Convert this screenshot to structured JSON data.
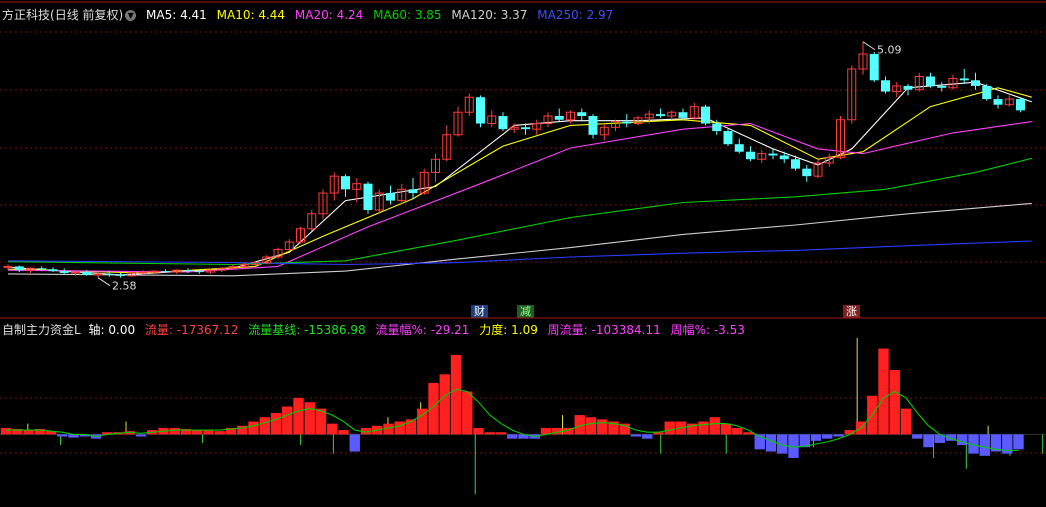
{
  "main_header": {
    "stock_name": "方正科技",
    "period_label": "(日线 前复权)",
    "ma5": "MA5: 4.41",
    "ma10": "MA10: 4.44",
    "ma20": "MA20: 4.24",
    "ma60": "MA60: 3.85",
    "ma120": "MA120: 3.37",
    "ma250": "MA250: 2.97"
  },
  "indicator_header": {
    "name": "自制主力资金L",
    "axis": "轴: 0.00",
    "flow": "流量: -17367.12",
    "flow_base": "流量基线: -15386.98",
    "flow_pct": "流量幅%: -29.21",
    "strength": "力度: 1.09",
    "week_flow": "周流量: -103384.11",
    "week_pct": "周幅%: -3.53"
  },
  "markers": {
    "fin": "财",
    "reduce": "减",
    "rise": "涨"
  },
  "colors": {
    "up": "#ff3c3c",
    "down": "#54ffff",
    "ma5": "#ffffff",
    "ma10": "#ffff00",
    "ma20": "#ff40ff",
    "ma60": "#00d000",
    "ma120": "#cfcfcf",
    "ma250": "#2a3cff",
    "flow_pos": "#ff2020",
    "flow_neg": "#5a5aff",
    "flow_line": "#00cc00",
    "grid": "#7a1010"
  },
  "chart_data": [
    {
      "type": "candlestick",
      "title": "方正科技 (日线 前复权)",
      "ylim": [
        2.3,
        5.3
      ],
      "high_label": "5.09",
      "low_label": "2.58",
      "candles": [
        [
          2.69,
          2.72,
          2.66,
          2.7
        ],
        [
          2.7,
          2.71,
          2.64,
          2.66
        ],
        [
          2.66,
          2.69,
          2.63,
          2.68
        ],
        [
          2.68,
          2.7,
          2.65,
          2.67
        ],
        [
          2.67,
          2.69,
          2.64,
          2.65
        ],
        [
          2.65,
          2.68,
          2.61,
          2.63
        ],
        [
          2.63,
          2.66,
          2.6,
          2.64
        ],
        [
          2.64,
          2.66,
          2.6,
          2.61
        ],
        [
          2.61,
          2.64,
          2.58,
          2.62
        ],
        [
          2.62,
          2.65,
          2.59,
          2.61
        ],
        [
          2.61,
          2.63,
          2.58,
          2.6
        ],
        [
          2.6,
          2.64,
          2.59,
          2.63
        ],
        [
          2.63,
          2.66,
          2.61,
          2.64
        ],
        [
          2.64,
          2.66,
          2.62,
          2.65
        ],
        [
          2.65,
          2.67,
          2.63,
          2.64
        ],
        [
          2.64,
          2.67,
          2.62,
          2.66
        ],
        [
          2.66,
          2.68,
          2.63,
          2.65
        ],
        [
          2.65,
          2.67,
          2.62,
          2.64
        ],
        [
          2.64,
          2.67,
          2.62,
          2.66
        ],
        [
          2.66,
          2.69,
          2.64,
          2.68
        ],
        [
          2.68,
          2.72,
          2.66,
          2.7
        ],
        [
          2.7,
          2.74,
          2.68,
          2.72
        ],
        [
          2.72,
          2.76,
          2.7,
          2.74
        ],
        [
          2.74,
          2.82,
          2.72,
          2.8
        ],
        [
          2.8,
          2.9,
          2.78,
          2.88
        ],
        [
          2.88,
          2.99,
          2.86,
          2.96
        ],
        [
          2.96,
          3.12,
          2.94,
          3.1
        ],
        [
          3.1,
          3.3,
          3.08,
          3.26
        ],
        [
          3.26,
          3.52,
          3.2,
          3.48
        ],
        [
          3.48,
          3.7,
          3.4,
          3.66
        ],
        [
          3.66,
          3.68,
          3.44,
          3.52
        ],
        [
          3.52,
          3.64,
          3.38,
          3.58
        ],
        [
          3.58,
          3.6,
          3.26,
          3.3
        ],
        [
          3.3,
          3.52,
          3.26,
          3.48
        ],
        [
          3.48,
          3.56,
          3.36,
          3.4
        ],
        [
          3.4,
          3.58,
          3.36,
          3.52
        ],
        [
          3.52,
          3.64,
          3.42,
          3.48
        ],
        [
          3.48,
          3.74,
          3.46,
          3.7
        ],
        [
          3.7,
          3.9,
          3.6,
          3.84
        ],
        [
          3.84,
          4.2,
          3.82,
          4.1
        ],
        [
          4.1,
          4.4,
          4.08,
          4.34
        ],
        [
          4.34,
          4.54,
          4.3,
          4.5
        ],
        [
          4.5,
          4.52,
          4.18,
          4.22
        ],
        [
          4.22,
          4.36,
          4.18,
          4.3
        ],
        [
          4.3,
          4.34,
          4.14,
          4.16
        ],
        [
          4.16,
          4.22,
          4.12,
          4.18
        ],
        [
          4.18,
          4.22,
          4.1,
          4.16
        ],
        [
          4.16,
          4.26,
          4.1,
          4.22
        ],
        [
          4.22,
          4.34,
          4.18,
          4.3
        ],
        [
          4.3,
          4.38,
          4.24,
          4.26
        ],
        [
          4.26,
          4.36,
          4.22,
          4.34
        ],
        [
          4.34,
          4.38,
          4.24,
          4.3
        ],
        [
          4.3,
          4.32,
          4.06,
          4.1
        ],
        [
          4.1,
          4.22,
          4.04,
          4.18
        ],
        [
          4.18,
          4.26,
          4.14,
          4.24
        ],
        [
          4.24,
          4.32,
          4.18,
          4.22
        ],
        [
          4.22,
          4.3,
          4.2,
          4.28
        ],
        [
          4.28,
          4.36,
          4.22,
          4.32
        ],
        [
          4.32,
          4.38,
          4.28,
          4.3
        ],
        [
          4.3,
          4.36,
          4.26,
          4.34
        ],
        [
          4.34,
          4.38,
          4.26,
          4.28
        ],
        [
          4.28,
          4.44,
          4.26,
          4.4
        ],
        [
          4.4,
          4.42,
          4.2,
          4.22
        ],
        [
          4.22,
          4.26,
          4.1,
          4.14
        ],
        [
          4.14,
          4.16,
          3.98,
          4.0
        ],
        [
          4.0,
          4.06,
          3.9,
          3.92
        ],
        [
          3.92,
          3.98,
          3.82,
          3.84
        ],
        [
          3.84,
          3.94,
          3.8,
          3.9
        ],
        [
          3.9,
          3.96,
          3.84,
          3.88
        ],
        [
          3.88,
          3.92,
          3.8,
          3.84
        ],
        [
          3.84,
          3.88,
          3.72,
          3.74
        ],
        [
          3.74,
          3.78,
          3.6,
          3.66
        ],
        [
          3.66,
          3.84,
          3.64,
          3.8
        ],
        [
          3.8,
          3.9,
          3.76,
          3.86
        ],
        [
          3.86,
          4.3,
          3.84,
          4.26
        ],
        [
          4.26,
          4.84,
          4.22,
          4.8
        ],
        [
          4.8,
          5.09,
          4.74,
          4.96
        ],
        [
          4.96,
          4.98,
          4.66,
          4.68
        ],
        [
          4.68,
          4.72,
          4.54,
          4.56
        ],
        [
          4.56,
          4.66,
          4.5,
          4.62
        ],
        [
          4.62,
          4.64,
          4.52,
          4.58
        ],
        [
          4.58,
          4.76,
          4.56,
          4.72
        ],
        [
          4.72,
          4.76,
          4.6,
          4.62
        ],
        [
          4.62,
          4.66,
          4.56,
          4.6
        ],
        [
          4.6,
          4.74,
          4.58,
          4.7
        ],
        [
          4.7,
          4.8,
          4.64,
          4.68
        ],
        [
          4.68,
          4.76,
          4.58,
          4.62
        ],
        [
          4.62,
          4.64,
          4.46,
          4.48
        ],
        [
          4.48,
          4.52,
          4.38,
          4.42
        ],
        [
          4.42,
          4.52,
          4.4,
          4.48
        ],
        [
          4.48,
          4.5,
          4.34,
          4.36
        ]
      ],
      "ma": {
        "MA5": [
          [
            0,
            2.69
          ],
          [
            10,
            2.61
          ],
          [
            20,
            2.68
          ],
          [
            25,
            2.85
          ],
          [
            30,
            3.4
          ],
          [
            38,
            3.55
          ],
          [
            45,
            4.2
          ],
          [
            50,
            4.25
          ],
          [
            56,
            4.25
          ],
          [
            62,
            4.28
          ],
          [
            68,
            3.95
          ],
          [
            72,
            3.78
          ],
          [
            75,
            3.95
          ],
          [
            80,
            4.6
          ],
          [
            86,
            4.66
          ],
          [
            91,
            4.45
          ]
        ],
        "MA10": [
          [
            0,
            2.67
          ],
          [
            12,
            2.63
          ],
          [
            22,
            2.7
          ],
          [
            28,
            3.02
          ],
          [
            36,
            3.42
          ],
          [
            44,
            3.98
          ],
          [
            50,
            4.2
          ],
          [
            60,
            4.26
          ],
          [
            66,
            4.2
          ],
          [
            72,
            3.84
          ],
          [
            76,
            3.92
          ],
          [
            82,
            4.4
          ],
          [
            88,
            4.6
          ],
          [
            91,
            4.5
          ]
        ],
        "MA20": [
          [
            0,
            2.66
          ],
          [
            16,
            2.64
          ],
          [
            24,
            2.7
          ],
          [
            32,
            3.12
          ],
          [
            42,
            3.58
          ],
          [
            50,
            3.96
          ],
          [
            60,
            4.16
          ],
          [
            66,
            4.22
          ],
          [
            72,
            3.95
          ],
          [
            76,
            3.9
          ],
          [
            84,
            4.12
          ],
          [
            91,
            4.24
          ]
        ],
        "MA60": [
          [
            0,
            2.75
          ],
          [
            20,
            2.72
          ],
          [
            30,
            2.76
          ],
          [
            40,
            2.98
          ],
          [
            50,
            3.22
          ],
          [
            60,
            3.38
          ],
          [
            70,
            3.44
          ],
          [
            78,
            3.52
          ],
          [
            86,
            3.7
          ],
          [
            91,
            3.85
          ]
        ],
        "MA120": [
          [
            0,
            2.62
          ],
          [
            20,
            2.6
          ],
          [
            30,
            2.65
          ],
          [
            40,
            2.78
          ],
          [
            50,
            2.9
          ],
          [
            60,
            3.04
          ],
          [
            70,
            3.14
          ],
          [
            80,
            3.26
          ],
          [
            91,
            3.37
          ]
        ],
        "MA250": [
          [
            0,
            2.76
          ],
          [
            20,
            2.74
          ],
          [
            30,
            2.72
          ],
          [
            40,
            2.74
          ],
          [
            50,
            2.8
          ],
          [
            60,
            2.84
          ],
          [
            70,
            2.87
          ],
          [
            80,
            2.92
          ],
          [
            91,
            2.97
          ]
        ]
      }
    },
    {
      "type": "bar",
      "title": "自制主力资金L",
      "ylim": [
        -3.2,
        4.4
      ],
      "values": [
        0.3,
        0.25,
        0.2,
        0.25,
        0.15,
        -0.1,
        -0.15,
        -0.1,
        -0.2,
        0.1,
        0.1,
        0.15,
        -0.1,
        0.2,
        0.3,
        0.3,
        0.25,
        0.2,
        0.2,
        0.15,
        0.3,
        0.4,
        0.6,
        0.8,
        1.0,
        1.3,
        1.7,
        1.5,
        1.2,
        0.5,
        0.2,
        -0.8,
        0.3,
        0.4,
        0.5,
        0.6,
        0.7,
        1.2,
        2.4,
        2.8,
        3.7,
        2.0,
        0.3,
        0.1,
        0.1,
        -0.2,
        -0.2,
        -0.2,
        0.3,
        0.3,
        0.3,
        0.9,
        0.8,
        0.7,
        0.6,
        0.5,
        -0.1,
        -0.2,
        0.1,
        0.6,
        0.6,
        0.5,
        0.6,
        0.8,
        0.5,
        0.3,
        0.1,
        -0.7,
        -0.8,
        -0.9,
        -1.1,
        -0.6,
        -0.3,
        -0.2,
        -0.1,
        0.2,
        0.6,
        1.8,
        4.0,
        3.0,
        1.2,
        -0.2,
        -0.6,
        -0.4,
        -0.3,
        -0.5,
        -0.9,
        -1.0,
        -0.8,
        -0.9,
        -0.7
      ],
      "base_line": [
        0.2,
        0.2,
        0.2,
        0.2,
        0.15,
        0.1,
        0.0,
        0.0,
        -0.1,
        0.0,
        0.05,
        0.1,
        0.05,
        0.1,
        0.15,
        0.2,
        0.2,
        0.2,
        0.2,
        0.2,
        0.25,
        0.3,
        0.4,
        0.55,
        0.7,
        0.9,
        1.1,
        1.2,
        1.1,
        0.9,
        0.6,
        0.2,
        0.1,
        0.2,
        0.3,
        0.4,
        0.6,
        0.9,
        1.3,
        1.8,
        2.1,
        2.0,
        1.5,
        0.9,
        0.5,
        0.2,
        0.0,
        -0.1,
        0.0,
        0.1,
        0.2,
        0.4,
        0.5,
        0.55,
        0.5,
        0.4,
        0.2,
        0.1,
        0.1,
        0.2,
        0.3,
        0.4,
        0.45,
        0.5,
        0.5,
        0.4,
        0.2,
        -0.1,
        -0.3,
        -0.5,
        -0.6,
        -0.55,
        -0.45,
        -0.35,
        -0.2,
        0.0,
        0.3,
        0.9,
        1.7,
        2.0,
        1.7,
        1.0,
        0.4,
        0.0,
        -0.2,
        -0.35,
        -0.5,
        -0.6,
        -0.7,
        -0.75,
        -0.75
      ],
      "spikes": [
        [
          2,
          0.5
        ],
        [
          5,
          -0.5
        ],
        [
          11,
          0.6
        ],
        [
          18,
          -0.4
        ],
        [
          24,
          0.4
        ],
        [
          27,
          -0.5
        ],
        [
          30,
          -0.9
        ],
        [
          35,
          0.8
        ],
        [
          38,
          1.5
        ],
        [
          43,
          -2.8
        ],
        [
          51,
          0.9
        ],
        [
          60,
          -0.9
        ],
        [
          66,
          -0.9
        ],
        [
          74,
          -0.6
        ],
        [
          78,
          4.5
        ],
        [
          85,
          -1.1
        ],
        [
          88,
          -1.6
        ],
        [
          90,
          0.4
        ],
        [
          92,
          -1.0
        ],
        [
          95,
          -0.9
        ]
      ]
    }
  ]
}
